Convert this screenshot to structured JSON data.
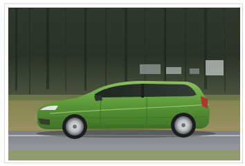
{
  "photo": {
    "subject": "car-side-profile",
    "colors": {
      "car_body": "#5c9a3a",
      "car_body_dark": "#3f7224",
      "car_body_light": "#8cc25d",
      "road": "#8e9097",
      "grass": "#8a8b52",
      "forest": "#2f3a2a",
      "frame_border": "#d8d8d8"
    }
  }
}
